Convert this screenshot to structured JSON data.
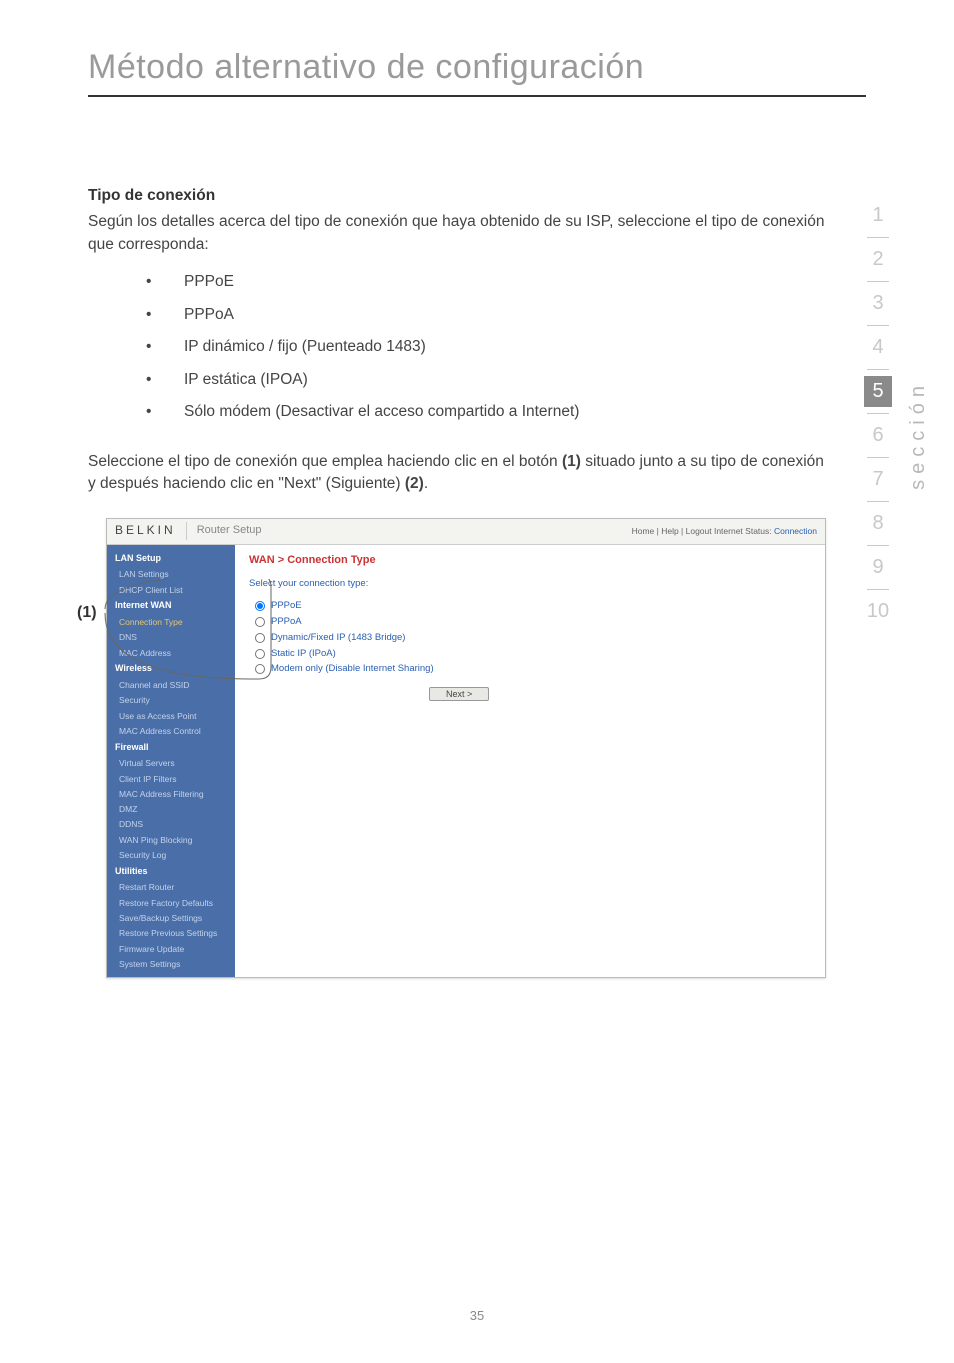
{
  "page": {
    "title": "Método alternativo de configuración",
    "number": "35"
  },
  "section_nav": {
    "items": [
      "1",
      "2",
      "3",
      "4",
      "5",
      "6",
      "7",
      "8",
      "9",
      "10"
    ],
    "active_index": 4,
    "label": "sección"
  },
  "body": {
    "heading": "Tipo de conexión",
    "intro": "Según los detalles acerca del tipo de conexión que haya obtenido de su ISP, seleccione el tipo de conexión que corresponda:",
    "bullets": [
      "PPPoE",
      "PPPoA",
      "IP dinámico / fijo (Puenteado 1483)",
      "IP estática (IPOA)",
      "Sólo módem (Desactivar el acceso compartido a Internet)"
    ],
    "para2_pre": "Seleccione el tipo de conexión que emplea haciendo clic en el botón ",
    "para2_b1": "(1)",
    "para2_mid": " situado junto a su tipo de conexión y después haciendo clic en \"Next\" (Siguiente) ",
    "para2_b2": "(2)",
    "para2_post": "."
  },
  "callout": {
    "one": "(1)"
  },
  "router": {
    "brand": "BELKIN",
    "top_title": "Router Setup",
    "top_right_prefix": "Home | Help | Logout   Internet Status: ",
    "top_right_status": "Connection",
    "sidebar": {
      "groups": [
        {
          "header": "LAN Setup",
          "items": [
            "LAN Settings",
            "DHCP Client List"
          ]
        },
        {
          "header": "Internet WAN",
          "items": [
            {
              "label": "Connection Type",
              "active": true
            },
            "DNS",
            "MAC Address"
          ]
        },
        {
          "header": "Wireless",
          "items": [
            "Channel and SSID",
            "Security",
            "Use as Access Point",
            "MAC Address Control"
          ]
        },
        {
          "header": "Firewall",
          "items": [
            "Virtual Servers",
            "Client IP Filters",
            "MAC Address Filtering",
            "DMZ",
            "DDNS",
            "WAN Ping Blocking",
            "Security Log"
          ]
        },
        {
          "header": "Utilities",
          "items": [
            "Restart Router",
            "Restore Factory Defaults",
            "Save/Backup Settings",
            "Restore Previous Settings",
            "Firmware Update",
            "System Settings"
          ]
        }
      ]
    },
    "main": {
      "title": "WAN > Connection Type",
      "subtitle": "Select your connection type:",
      "options": [
        {
          "label": "PPPoE",
          "checked": true
        },
        {
          "label": "PPPoA",
          "checked": false
        },
        {
          "label": "Dynamic/Fixed IP (1483 Bridge)",
          "checked": false
        },
        {
          "label": "Static IP (IPoA)",
          "checked": false
        },
        {
          "label": "Modem only (Disable Internet Sharing)",
          "checked": false
        }
      ],
      "next_label": "Next >"
    }
  },
  "chart_data": null
}
